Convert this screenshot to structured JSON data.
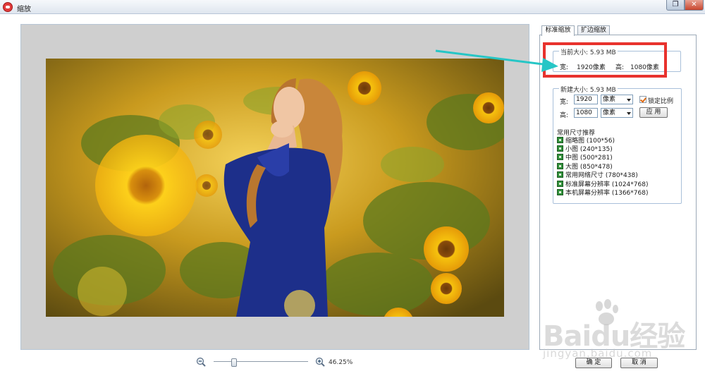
{
  "window": {
    "title": "缩放",
    "restore_glyph": "❐",
    "close_glyph": "✕"
  },
  "zoom": {
    "level": "46.25%",
    "slider_fraction": 0.2
  },
  "tabs": [
    {
      "label": "标准缩放",
      "active": true
    },
    {
      "label": "扩边缩放",
      "active": false
    }
  ],
  "current_size": {
    "legend": "当前大小: 5.93 MB",
    "width_label": "宽:",
    "width_value": "1920像素",
    "height_label": "高:",
    "height_value": "1080像素"
  },
  "new_size": {
    "legend": "新建大小: 5.93 MB",
    "width_label": "宽:",
    "width_value": "1920",
    "height_label": "高:",
    "height_value": "1080",
    "unit_selected": "像素",
    "lock_ratio_label": "锁定比例",
    "lock_ratio_checked": true,
    "apply_label": "应 用",
    "presets_title": "常用尺寸推荐",
    "presets": [
      {
        "label": "缩略图 (100*56)"
      },
      {
        "label": "小图 (240*135)"
      },
      {
        "label": "中图 (500*281)"
      },
      {
        "label": "大图 (850*478)"
      },
      {
        "label": "常用网络尺寸 (780*438)"
      },
      {
        "label": "标准屏幕分辨率 (1024*768)"
      },
      {
        "label": "本机屏幕分辨率 (1366*768)"
      }
    ]
  },
  "footer": {
    "ok_label": "确 定",
    "cancel_label": "取 消"
  },
  "watermark": {
    "logo": "Baidu经验",
    "url": "jingyan.baidu.com"
  },
  "colors": {
    "highlight": "#e8322d",
    "arrow": "#26c6c6"
  }
}
